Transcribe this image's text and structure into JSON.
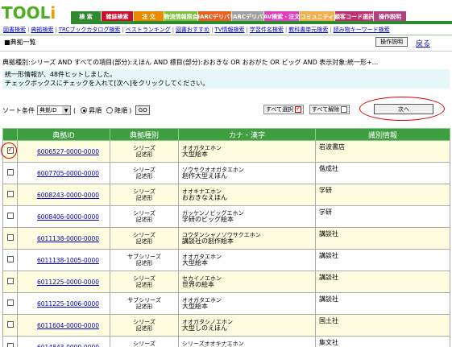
{
  "header": {
    "logo_main": "TOOL",
    "logo_accent": "i",
    "tabs": [
      {
        "label": "検 索",
        "color": "#2f8a2f",
        "width": 38
      },
      {
        "label": "雑誌検索",
        "color": "#c8102e",
        "width": 40
      },
      {
        "label": "注 文",
        "color": "#e88a00",
        "width": 38
      },
      {
        "label": "物流情報照会",
        "color": "#7bbf3f",
        "width": 42
      },
      {
        "label": "MARCデリバリ",
        "color": "#e86020",
        "width": 42
      },
      {
        "label": "MARCデリバリ",
        "color": "#a0a0a0",
        "width": 40
      },
      {
        "label": "AV検索・注文",
        "color": "#e040c0",
        "width": 44
      },
      {
        "label": "コミュニティ",
        "color": "#f0b050",
        "width": 44
      },
      {
        "label": "顧客コード選択",
        "color": "#c0306f",
        "width": 48
      },
      {
        "label": "操作説明",
        "color": "#b04080",
        "width": 41
      }
    ]
  },
  "subnav": {
    "links": [
      "図書検索",
      "典拠検索",
      "TRCブックカタログ検索",
      "ベストランキング",
      "図書おすすめ",
      "TV情報検索",
      "学習件名検索",
      "教科書単元検索",
      "読み物キーワード検索"
    ]
  },
  "page": {
    "title": "■典拠一覧",
    "help_button": "操作説明",
    "back_link": "戻る",
    "condition": "典拠種別:シリーズ AND すべての項目(部分):えほん AND 標目(部分):おおきな OR おおがた OR ビッグ AND 表示対象:統一形+...",
    "info_line1": "統一形情報が、48件ヒットしました。",
    "info_line2": "チェックボックスにチェックを入れて[次へ]をクリックしてください。"
  },
  "sort": {
    "label": "ソート条件",
    "selected": "典拠ID",
    "asc_label": "昇順",
    "desc_label": "降順",
    "paren_open": "(",
    "paren_close": ")",
    "go_label": "GO"
  },
  "actions": {
    "select_all": "すべて選択",
    "deselect_all": "すべて解除",
    "next": "次へ"
  },
  "table": {
    "headers": [
      "",
      "典拠ID",
      "典拠種別",
      "カナ・漢字",
      "識別情報"
    ],
    "rows": [
      {
        "checked": true,
        "id": "6006527-0000-0000",
        "type1": "シリーズ",
        "type2": "記述形",
        "kana": "オオガタエホン",
        "kanji": "大型絵本",
        "publisher": "岩波書店"
      },
      {
        "checked": false,
        "id": "6007705-0000-0000",
        "type1": "シリーズ",
        "type2": "記述形",
        "kana": "ソウサクオオガタエホン",
        "kanji": "創作大型えほん",
        "publisher": "偕成社"
      },
      {
        "checked": false,
        "id": "6008243-0000-0000",
        "type1": "シリーズ",
        "type2": "記述形",
        "kana": "オオキナエホン",
        "kanji": "おおきなえほん",
        "publisher": "学研"
      },
      {
        "checked": false,
        "id": "6008406-0000-0000",
        "type1": "シリーズ",
        "type2": "記述形",
        "kana": "ガッケンノビッグエホン",
        "kanji": "学研のビッグ絵本",
        "publisher": "学研"
      },
      {
        "checked": false,
        "id": "6011138-0000-0000",
        "type1": "シリーズ",
        "type2": "記述形",
        "kana": "コウダンシャノソウサクエホン",
        "kanji": "講談社の創作絵本",
        "publisher": "講談社"
      },
      {
        "checked": false,
        "id": "6011138-1005-0000",
        "type1": "サブシリーズ",
        "type2": "記述形",
        "kana": "オオガタエホン",
        "kanji": "大型絵本",
        "publisher": "講談社"
      },
      {
        "checked": false,
        "id": "6011225-0000-0000",
        "type1": "シリーズ",
        "type2": "記述形",
        "kana": "セカイノエホン",
        "kanji": "世界の絵本",
        "publisher": "講談社"
      },
      {
        "checked": false,
        "id": "6011225-1006-0000",
        "type1": "サブシリーズ",
        "type2": "記述形",
        "kana": "オオガタエホン",
        "kanji": "大型絵本",
        "publisher": "講談社"
      },
      {
        "checked": false,
        "id": "6011604-0000-0000",
        "type1": "シリーズ",
        "type2": "記述形",
        "kana": "オオガタシノエホン",
        "kanji": "大型しのえほん",
        "publisher": "国土社"
      },
      {
        "checked": false,
        "id": "6014843-0000-0000",
        "type1": "シリーズ",
        "type2": "記述形",
        "kana": "シリーズオオキナエホン",
        "kanji": "Series大きな絵本",
        "publisher": "集文社"
      }
    ]
  }
}
